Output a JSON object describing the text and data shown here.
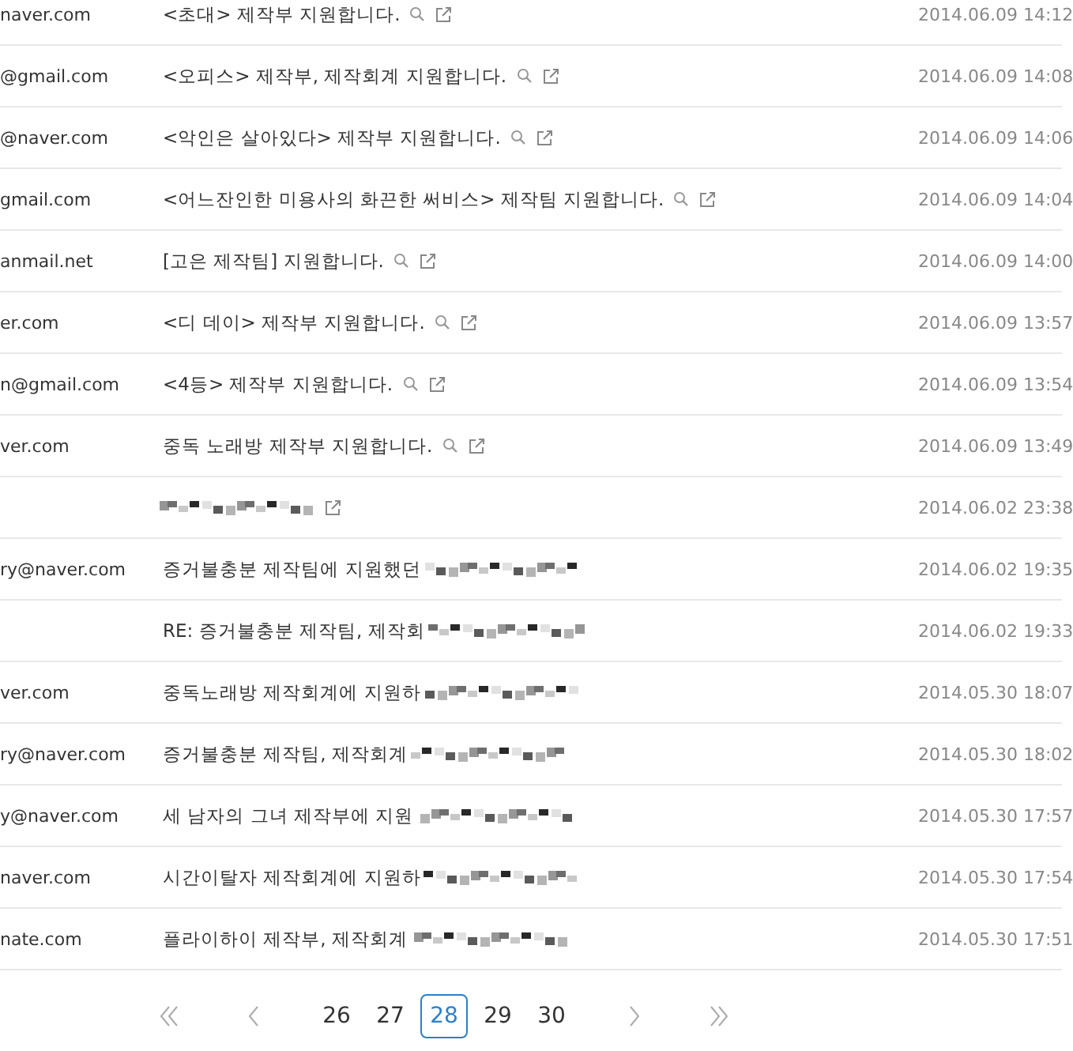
{
  "rows": [
    {
      "sender": "naver.com",
      "subject": "<초대> 제작부 지원합니다.",
      "search_icon": true,
      "link_icon": true,
      "redacted": false,
      "date": "2014.06.09 14:12"
    },
    {
      "sender": "@gmail.com",
      "subject": "<오피스> 제작부, 제작회계 지원합니다.",
      "search_icon": true,
      "link_icon": true,
      "redacted": false,
      "date": "2014.06.09 14:08"
    },
    {
      "sender": "@naver.com",
      "subject": "<악인은 살아있다> 제작부 지원합니다.",
      "search_icon": true,
      "link_icon": true,
      "redacted": false,
      "date": "2014.06.09 14:06"
    },
    {
      "sender": "gmail.com",
      "subject": "<어느잔인한 미용사의 화끈한 써비스> 제작팀 지원합니다.",
      "search_icon": true,
      "link_icon": true,
      "redacted": false,
      "date": "2014.06.09 14:04"
    },
    {
      "sender": "anmail.net",
      "subject": "[고은 제작팀] 지원합니다.",
      "search_icon": true,
      "link_icon": true,
      "redacted": false,
      "date": "2014.06.09 14:00"
    },
    {
      "sender": "er.com",
      "subject": "<디 데이> 제작부 지원합니다.",
      "search_icon": true,
      "link_icon": true,
      "redacted": false,
      "date": "2014.06.09 13:57"
    },
    {
      "sender": "n@gmail.com",
      "subject": "<4등> 제작부 지원합니다.",
      "search_icon": true,
      "link_icon": true,
      "redacted": false,
      "date": "2014.06.09 13:54"
    },
    {
      "sender": "ver.com",
      "subject": "중독 노래방 제작부 지원합니다.",
      "search_icon": true,
      "link_icon": true,
      "redacted": false,
      "date": "2014.06.09 13:49"
    },
    {
      "search_icon": false,
      "link_icon": true,
      "redacted": true,
      "date": "2014.06.02 23:38"
    },
    {
      "sender": "ry@naver.com",
      "subject": "증거불충분 제작팀에 지원했던",
      "search_icon": false,
      "link_icon": false,
      "redacted": true,
      "date": "2014.06.02 19:35"
    },
    {
      "subject": "RE: 증거불충분 제작팀, 제작회",
      "search_icon": false,
      "link_icon": false,
      "redacted": true,
      "date": "2014.06.02 19:33"
    },
    {
      "sender": "ver.com",
      "subject": "중독노래방 제작회계에 지원하",
      "search_icon": false,
      "link_icon": false,
      "redacted": true,
      "date": "2014.05.30 18:07"
    },
    {
      "sender": "ry@naver.com",
      "subject": "증거불충분 제작팀, 제작회계",
      "search_icon": false,
      "link_icon": false,
      "redacted": true,
      "date": "2014.05.30 18:02"
    },
    {
      "sender": "y@naver.com",
      "subject": "세 남자의 그녀 제작부에 지원",
      "search_icon": false,
      "link_icon": false,
      "redacted": true,
      "date": "2014.05.30 17:57"
    },
    {
      "sender": "naver.com",
      "subject": "시간이탈자 제작회계에 지원하",
      "search_icon": false,
      "link_icon": false,
      "redacted": true,
      "date": "2014.05.30 17:54"
    },
    {
      "sender": "nate.com",
      "subject": "플라이하이 제작부, 제작회계",
      "search_icon": false,
      "link_icon": false,
      "redacted": true,
      "date": "2014.05.30 17:51"
    }
  ],
  "pagination": {
    "pages": [
      {
        "label": "26",
        "selected": false
      },
      {
        "label": "27",
        "selected": false
      },
      {
        "label": "28",
        "selected": true
      },
      {
        "label": "29",
        "selected": false
      },
      {
        "label": "30",
        "selected": false
      }
    ]
  }
}
